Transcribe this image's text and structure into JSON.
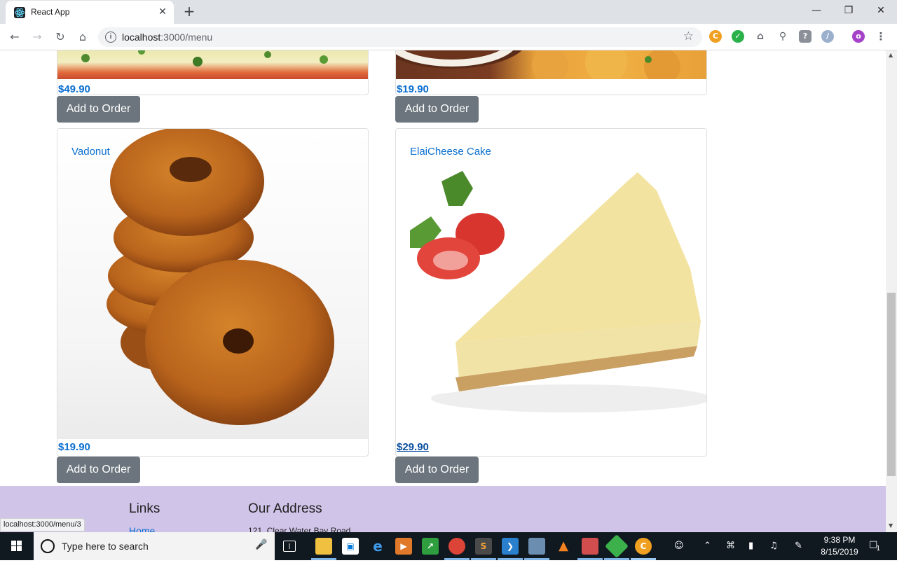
{
  "browser": {
    "tab_title": "React App",
    "tab_close": "✕",
    "new_tab": "+",
    "url_host": "localhost",
    "url_path": ":3000/menu",
    "window_controls": [
      "—",
      "❐",
      "✕"
    ],
    "profile_initial": "o",
    "status_url": "localhost:3000/menu/3"
  },
  "menu": {
    "top_row": [
      {
        "price": "$49.90",
        "button": "Add to Order"
      },
      {
        "price": "$19.90",
        "button": "Add to Order"
      }
    ],
    "cards": [
      {
        "title": "Vadonut",
        "price": "$19.90",
        "button": "Add to Order"
      },
      {
        "title": "ElaiCheese Cake",
        "price": "$29.90",
        "button": "Add to Order"
      }
    ]
  },
  "footer": {
    "links_heading": "Links",
    "home_link": "Home",
    "address_heading": "Our Address",
    "address_line1": "121, Clear Water Bay Road"
  },
  "taskbar": {
    "search_placeholder": "Type here to search",
    "time": "9:38 PM",
    "date": "8/15/2019",
    "notification_count": "1"
  },
  "colors": {
    "accent_blue": "#0b6fd0",
    "button_gray": "#6c757d",
    "footer_purple": "#d1c4e9"
  }
}
